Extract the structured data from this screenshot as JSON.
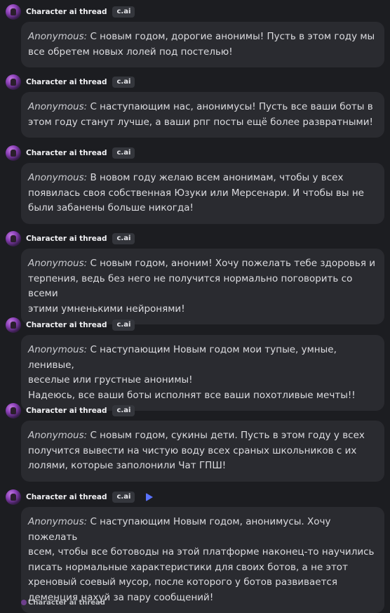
{
  "thread": {
    "author_name": "Character ai thread",
    "badge": "c.ai",
    "prefix": "Anonymous:",
    "messages": [
      {
        "lines": [
          "С новым годом, дорогие анонимы! Пусть в этом году мы",
          "все обретем новых лолей под постелью!"
        ]
      },
      {
        "lines": [
          "С наступающим нас, анонимусы! Пусть все ваши боты в",
          "этом году станут лучше, а ваши рпг посты ещё более развратными!"
        ]
      },
      {
        "lines": [
          "В новом году желаю всем анонимам, чтобы у всех",
          "появилась своя собственная Юзуки или Мерсенари. И чтобы вы не",
          "были забанены больше никогда!"
        ]
      },
      {
        "lines": [
          "С новым годом, аноним! Хочу пожелать тебе здоровья и",
          "терпения, ведь без него не получится нормально поговорить со всеми",
          "этими умненькими нейронями!"
        ]
      },
      {
        "lines": [
          "С наступающим Новым годом мои тупые, умные, ленивые,",
          "веселые или грустные анонимы!",
          "Надеюсь, все ваши боты исполнят все ваши похотливые мечты!!"
        ]
      },
      {
        "lines": [
          "С новым годом, сукины дети. Пусть в этом году у всех",
          "получится вывести на чистую воду всех сраных школьников с их",
          "лолями, которые заполонили Чат ГПШ!"
        ]
      },
      {
        "lines": [
          "С наступающим Новым годом, анонимусы. Хочу пожелать",
          "всем, чтобы все ботоводы на этой платформе наконец-то научились",
          "писать нормальные характеристики для своих ботов, а не этот",
          "хреновый соевый мусор, после которого у ботов развивается",
          "деменция нахуй за пару сообщений!"
        ]
      }
    ],
    "footer_partial_name": "Character ai thread"
  },
  "colors": {
    "background": "#1c1d21",
    "bubble": "#2a2b30",
    "badge": "#34363c",
    "accent": "#5a73ff"
  }
}
